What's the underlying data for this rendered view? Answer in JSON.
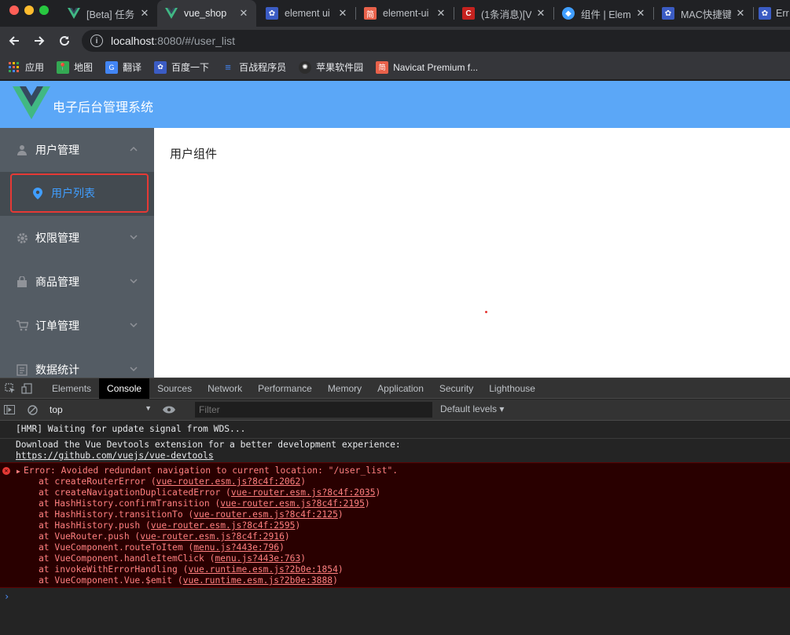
{
  "colors": {
    "header": "#5ba7f7",
    "sidebar": "#545c64",
    "accent": "#409eff",
    "error": "#ff8080"
  },
  "tabs": [
    {
      "title": "[Beta] 任务",
      "icon": "vue-icon",
      "active": false
    },
    {
      "title": "vue_shop",
      "icon": "vue-icon",
      "active": true
    },
    {
      "title": "element ui",
      "icon": "paw-icon",
      "active": false
    },
    {
      "title": "element-ui",
      "icon": "jian-icon",
      "active": false
    },
    {
      "title": "(1条消息)[V",
      "icon": "csdn-icon",
      "active": false
    },
    {
      "title": "组件 | Elem",
      "icon": "element-icon",
      "active": false
    },
    {
      "title": "MAC快捷键",
      "icon": "paw-icon",
      "active": false
    },
    {
      "title": "Err",
      "icon": "paw-icon",
      "active": false
    }
  ],
  "address": {
    "host": "localhost",
    "path": ":8080/#/user_list"
  },
  "bookmarks": [
    "应用",
    "地图",
    "翻译",
    "百度一下",
    "百战程序员",
    "苹果软件园",
    "Navicat Premium f..."
  ],
  "app": {
    "title": "电子后台管理系统"
  },
  "menu": {
    "user": "用户管理",
    "user_list": "用户列表",
    "permission": "权限管理",
    "goods": "商品管理",
    "orders": "订单管理",
    "stats": "数据统计"
  },
  "main": {
    "text": "用户组件"
  },
  "devtools": {
    "tabs": [
      "Elements",
      "Console",
      "Sources",
      "Network",
      "Performance",
      "Memory",
      "Application",
      "Security",
      "Lighthouse"
    ],
    "context": "top",
    "filter_placeholder": "Filter",
    "levels": "Default levels ▾"
  },
  "console": {
    "hmr": "[HMR] Waiting for update signal from WDS...",
    "devtools_line1": "Download the Vue Devtools extension for a better development experience:",
    "devtools_link": "https://github.com/vuejs/vue-devtools",
    "error": "Error: Avoided redundant navigation to current location: \"/user_list\".",
    "frames": [
      {
        "fn": "at createRouterError (",
        "loc": "vue-router.esm.js?8c4f:2062",
        "end": ")"
      },
      {
        "fn": "at createNavigationDuplicatedError (",
        "loc": "vue-router.esm.js?8c4f:2035",
        "end": ")"
      },
      {
        "fn": "at HashHistory.confirmTransition (",
        "loc": "vue-router.esm.js?8c4f:2195",
        "end": ")"
      },
      {
        "fn": "at HashHistory.transitionTo (",
        "loc": "vue-router.esm.js?8c4f:2125",
        "end": ")"
      },
      {
        "fn": "at HashHistory.push (",
        "loc": "vue-router.esm.js?8c4f:2595",
        "end": ")"
      },
      {
        "fn": "at VueRouter.push (",
        "loc": "vue-router.esm.js?8c4f:2916",
        "end": ")"
      },
      {
        "fn": "at VueComponent.routeToItem (",
        "loc": "menu.js?443e:796",
        "end": ")"
      },
      {
        "fn": "at VueComponent.handleItemClick (",
        "loc": "menu.js?443e:763",
        "end": ")"
      },
      {
        "fn": "at invokeWithErrorHandling (",
        "loc": "vue.runtime.esm.js?2b0e:1854",
        "end": ")"
      },
      {
        "fn": "at VueComponent.Vue.$emit (",
        "loc": "vue.runtime.esm.js?2b0e:3888",
        "end": ")"
      }
    ]
  }
}
